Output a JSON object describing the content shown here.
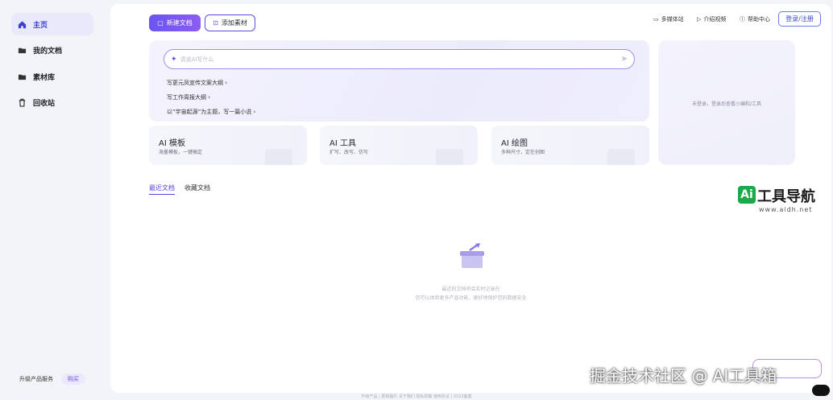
{
  "sidebar": {
    "items": [
      {
        "label": "主页",
        "icon": "home-icon"
      },
      {
        "label": "我的文档",
        "icon": "folder-icon"
      },
      {
        "label": "素材库",
        "icon": "folder-icon"
      },
      {
        "label": "回收站",
        "icon": "trash-icon"
      }
    ],
    "upgrade_label": "升级产品服务",
    "buy_label": "购买"
  },
  "toolbar": {
    "new_doc": "新建文档",
    "add_material": "添加素材",
    "multimedia": "多媒体站",
    "guide_video": "介绍视频",
    "help": "帮助中心",
    "login": "登录/注册"
  },
  "hero": {
    "search_placeholder": "请说AI写什么",
    "suggestions": [
      "写更元凤宣传文案大纲 ›",
      "写工作周报大纲 ›",
      "以“宇宙起源”为主题，写一篇小说 ›"
    ]
  },
  "cards": [
    {
      "title": "AI 模板",
      "sub": "海量模板，一键搞定"
    },
    {
      "title": "AI 工具",
      "sub": "扩写、改写、仿写"
    },
    {
      "title": "AI 绘图",
      "sub": "多种尺寸，定在创图"
    }
  ],
  "right_panel": {
    "message": "未登录，登录后查看小编和/工具"
  },
  "tabs": [
    {
      "label": "最近文档",
      "active": true
    },
    {
      "label": "收藏文档",
      "active": false
    }
  ],
  "empty": {
    "line1": "最近的文档将会实时记录在",
    "line2": "您可以体验更多产品功能，更好地保护您的数据安全"
  },
  "footer": "升级产品 | 更新履历 关于我们 隐私政策 使用协议 | 2023备案",
  "watermarks": {
    "logo_ai": "Ai",
    "logo_name": "工具导航",
    "logo_url": "www.aidh.net",
    "bottom": "掘金技术社区 @ AI工具箱"
  },
  "colors": {
    "accent": "#6a55f0",
    "active_bg": "#e9e9fb",
    "brand_green": "#1ba94c"
  }
}
